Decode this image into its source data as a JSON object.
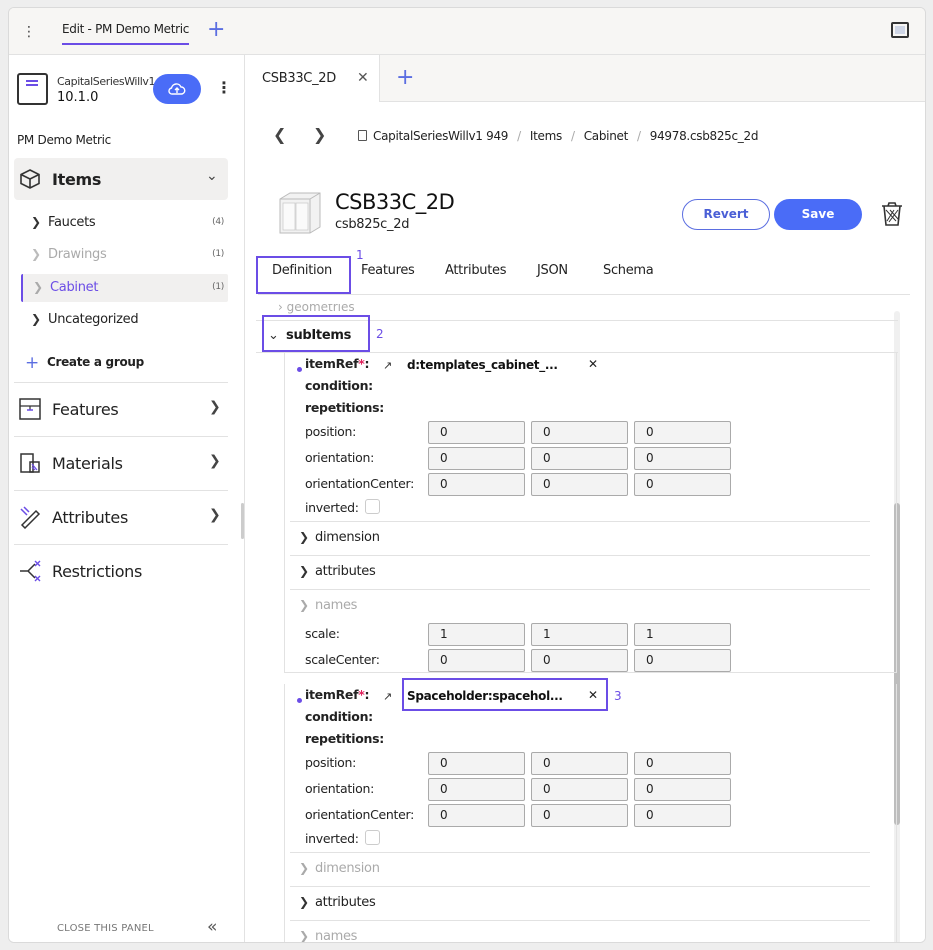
{
  "topbar": {
    "tab_label": "Edit - PM Demo Metric",
    "add_icon": "+"
  },
  "sidebar": {
    "project_name": "CapitalSeriesWillv1",
    "project_version": "10.1.0",
    "project_title": "PM Demo Metric",
    "items_label": "Items",
    "tree": [
      {
        "label": "Faucets",
        "count": "(4)"
      },
      {
        "label": "Drawings",
        "count": "(1)"
      },
      {
        "label": "Cabinet",
        "count": "(1)"
      },
      {
        "label": "Uncategorized",
        "count": ""
      }
    ],
    "create_group": "Create a group",
    "sections": [
      "Features",
      "Materials",
      "Attributes",
      "Restrictions"
    ],
    "close_panel": "CLOSE THIS PANEL"
  },
  "doc": {
    "tab_label": "CSB33C_2D",
    "breadcrumb": [
      "CapitalSeriesWillv1 949",
      "Items",
      "Cabinet",
      "94978.csb825c_2d"
    ],
    "title": "CSB33C_2D",
    "subtitle": "csb825c_2d",
    "revert_label": "Revert",
    "save_label": "Save",
    "tabs": [
      "Definition",
      "Features",
      "Attributes",
      "JSON",
      "Schema"
    ],
    "annotation_numbers": [
      "1",
      "2",
      "3"
    ]
  },
  "editor": {
    "section_label": "subItems",
    "item1": {
      "ref_label": "itemRef",
      "ref_value": "d:templates_cabinet_...",
      "condition_label": "condition:",
      "repetitions_label": "repetitions:",
      "position_label": "position:",
      "position": [
        "0",
        "0",
        "0"
      ],
      "orientation_label": "orientation:",
      "orientation": [
        "0",
        "0",
        "0"
      ],
      "orientation_center_label": "orientationCenter:",
      "orientation_center": [
        "0",
        "0",
        "0"
      ],
      "inverted_label": "inverted:",
      "dimension_label": "dimension",
      "attributes_label": "attributes",
      "names_label": "names",
      "scale_label": "scale:",
      "scale": [
        "1",
        "1",
        "1"
      ],
      "scale_center_label": "scaleCenter:",
      "scale_center": [
        "0",
        "0",
        "0"
      ]
    },
    "item2": {
      "ref_label": "itemRef",
      "ref_value": "Spaceholder:spacehol...",
      "condition_label": "condition:",
      "repetitions_label": "repetitions:",
      "position_label": "position:",
      "position": [
        "0",
        "0",
        "0"
      ],
      "orientation_label": "orientation:",
      "orientation": [
        "0",
        "0",
        "0"
      ],
      "orientation_center_label": "orientationCenter:",
      "orientation_center": [
        "0",
        "0",
        "0"
      ],
      "inverted_label": "inverted:",
      "dimension_label": "dimension",
      "attributes_label": "attributes",
      "names_label": "names"
    }
  },
  "colors": {
    "accent": "#6b4de6",
    "primary": "#4a6cf7",
    "required": "#e0245e"
  }
}
